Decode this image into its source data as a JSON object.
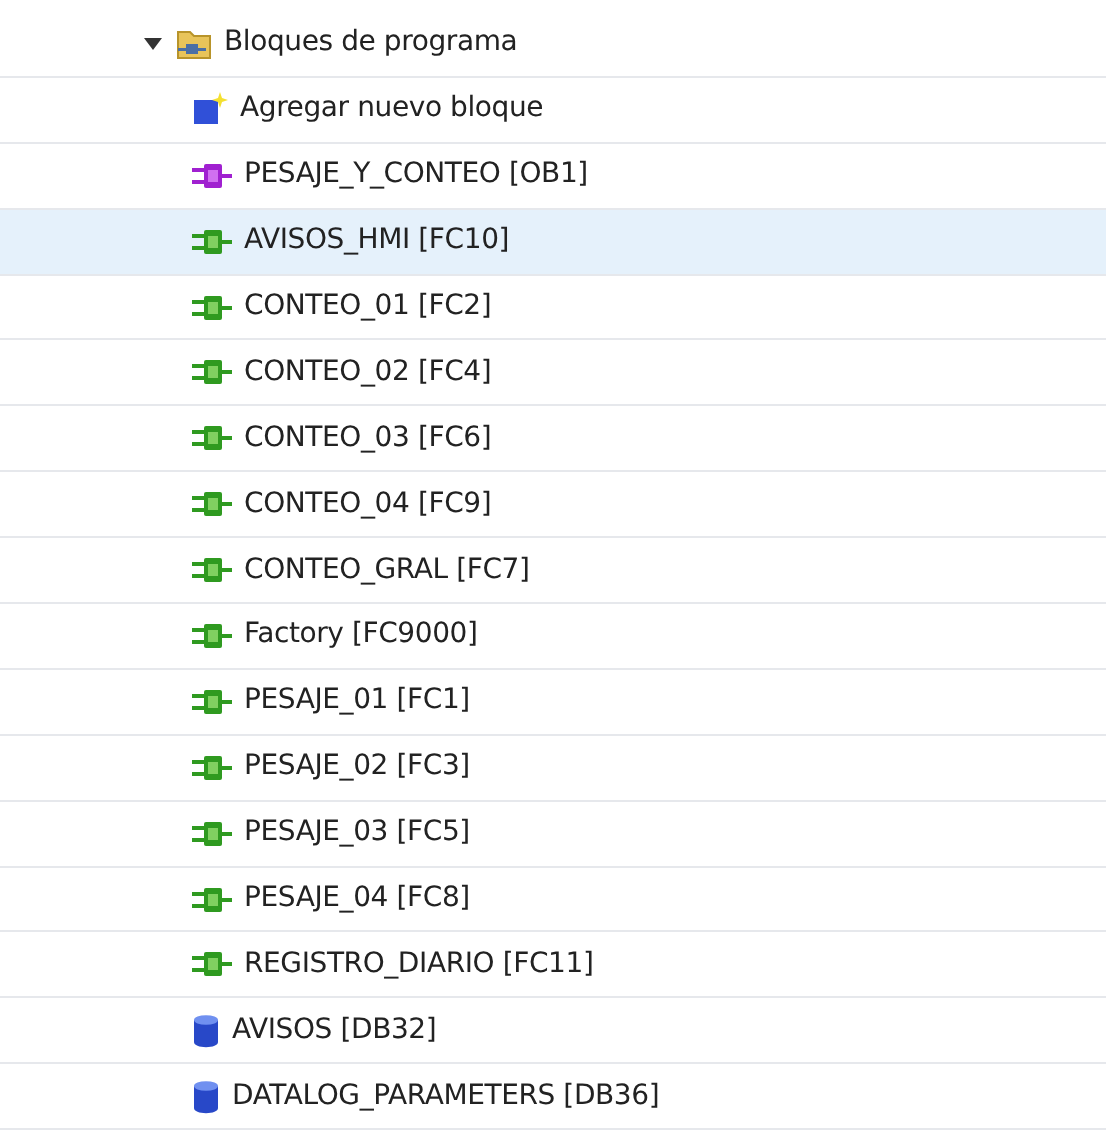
{
  "tree": {
    "label": "Bloques de programa",
    "kind": "folder",
    "expanded": true,
    "selected": false,
    "children": [
      {
        "label": "Agregar nuevo bloque",
        "kind": "add",
        "selected": false
      },
      {
        "label": "PESAJE_Y_CONTEO [OB1]",
        "kind": "ob",
        "selected": false
      },
      {
        "label": "AVISOS_HMI [FC10]",
        "kind": "fc",
        "selected": true
      },
      {
        "label": "CONTEO_01 [FC2]",
        "kind": "fc",
        "selected": false
      },
      {
        "label": "CONTEO_02 [FC4]",
        "kind": "fc",
        "selected": false
      },
      {
        "label": "CONTEO_03 [FC6]",
        "kind": "fc",
        "selected": false
      },
      {
        "label": "CONTEO_04 [FC9]",
        "kind": "fc",
        "selected": false
      },
      {
        "label": "CONTEO_GRAL [FC7]",
        "kind": "fc",
        "selected": false
      },
      {
        "label": "Factory [FC9000]",
        "kind": "fc",
        "selected": false
      },
      {
        "label": "PESAJE_01 [FC1]",
        "kind": "fc",
        "selected": false
      },
      {
        "label": "PESAJE_02 [FC3]",
        "kind": "fc",
        "selected": false
      },
      {
        "label": "PESAJE_03 [FC5]",
        "kind": "fc",
        "selected": false
      },
      {
        "label": "PESAJE_04 [FC8]",
        "kind": "fc",
        "selected": false
      },
      {
        "label": "REGISTRO_DIARIO [FC11]",
        "kind": "fc",
        "selected": false
      },
      {
        "label": "AVISOS [DB32]",
        "kind": "db",
        "selected": false
      },
      {
        "label": "DATALOG_PARAMETERS [DB36]",
        "kind": "db",
        "selected": false
      }
    ]
  }
}
